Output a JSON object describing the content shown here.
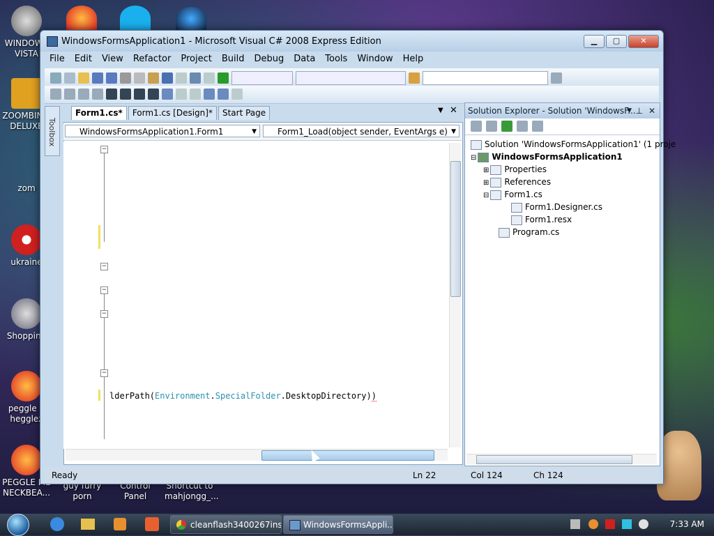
{
  "desktop": {
    "icons": [
      {
        "label": "WINDOWS VISTA",
        "icon": "windows-vista-icon"
      },
      {
        "label": "ZOOMBINIS DELUXE",
        "icon": "zoombinis-icon"
      },
      {
        "label": "zom",
        "icon": "plant-icon"
      },
      {
        "label": "ukraine",
        "icon": "radiation-icon"
      },
      {
        "label": "Shopping",
        "icon": "flash-icon"
      },
      {
        "label": "peggle n hegglez",
        "icon": "peggle-icon"
      },
      {
        "label": "PEGGLE ME NECKBEA...",
        "icon": "peggle-icon"
      },
      {
        "label": "guy furry porn",
        "icon": "folder-icon"
      },
      {
        "label": "Control Panel",
        "icon": "control-panel-icon"
      },
      {
        "label": "Shortcut to mahjongg_...",
        "icon": "shortcut-icon"
      }
    ]
  },
  "window": {
    "title": "WindowsFormsApplication1 - Microsoft Visual C# 2008 Express Edition",
    "minimize": "▁",
    "maximize": "▢",
    "close": "✕"
  },
  "menu": [
    "File",
    "Edit",
    "View",
    "Refactor",
    "Project",
    "Build",
    "Debug",
    "Data",
    "Tools",
    "Window",
    "Help"
  ],
  "tabs": {
    "items": [
      "Form1.cs*",
      "Form1.cs [Design]*",
      "Start Page"
    ],
    "active": "Form1.cs*"
  },
  "toolbox_label": "Toolbox",
  "nav": {
    "class_combo": "WindowsFormsApplication1.Form1",
    "member_combo": "Form1_Load(object sender, EventArgs e)"
  },
  "editor": {
    "code_prefix": "lderPath(",
    "code_kw1": "Environment",
    "code_dot1": ".",
    "code_kw2": "SpecialFolder",
    "code_suffix": ".DesktopDirectory)",
    "code_tail": ")"
  },
  "solution_explorer": {
    "title": "Solution Explorer - Solution 'WindowsF...",
    "pin": "⊥",
    "close": "✕",
    "items": [
      {
        "label": "Solution 'WindowsFormsApplication1' (1 proje",
        "icon": "solution-icon"
      },
      {
        "label": "WindowsFormsApplication1",
        "icon": "csharp-project-icon",
        "bold": true
      },
      {
        "label": "Properties",
        "icon": "properties-folder-icon"
      },
      {
        "label": "References",
        "icon": "references-folder-icon"
      },
      {
        "label": "Form1.cs",
        "icon": "form-icon"
      },
      {
        "label": "Form1.Designer.cs",
        "icon": "cs-file-icon"
      },
      {
        "label": "Form1.resx",
        "icon": "resx-file-icon"
      },
      {
        "label": "Program.cs",
        "icon": "cs-file-icon"
      }
    ]
  },
  "status": {
    "text": "Ready",
    "ln": "Ln 22",
    "col": "Col 124",
    "ch": "Ch 124"
  },
  "taskbar": {
    "tasks": [
      {
        "label": "cleanflash3400267ins...",
        "icon": "chrome-icon"
      },
      {
        "label": "WindowsFormsAppli...",
        "icon": "visual-studio-icon",
        "active": true
      }
    ],
    "time": "7:33 AM"
  }
}
